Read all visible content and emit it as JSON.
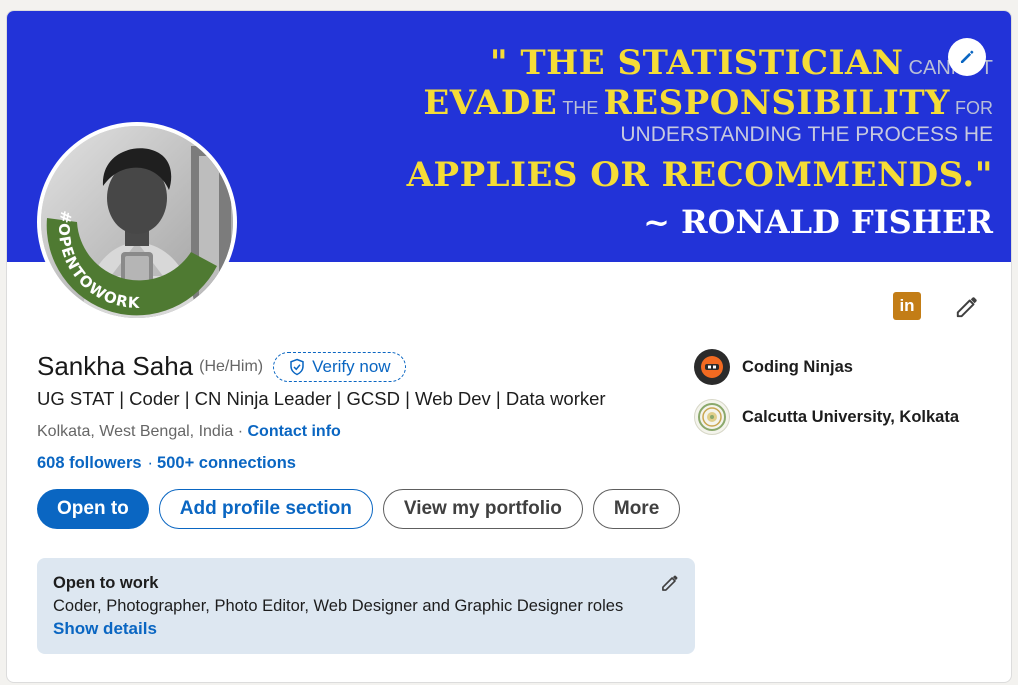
{
  "banner": {
    "quote_line1_open": "\" THE  STATISTICIAN",
    "quote_line1_small": "CANNOT",
    "quote_line2_a": "EVADE",
    "quote_line2_b": "THE",
    "quote_line2_c": "RESPONSIBILITY",
    "quote_line2_d": "FOR",
    "quote_line3": "UNDERSTANDING THE PROCESS HE",
    "quote_line4": "APPLIES OR RECOMMENDS.\"",
    "quote_author": "~ RONALD FISHER",
    "bg_color": "#2233d8"
  },
  "avatar": {
    "badge_text": "#OPENTOWORK",
    "ring_color": "#4f7a32"
  },
  "profile": {
    "name": "Sankha Saha",
    "pronouns": "(He/Him)",
    "verify_label": "Verify now",
    "headline": "UG STAT | Coder | CN Ninja Leader | GCSD | Web Dev | Data worker",
    "location": "Kolkata, West Bengal, India",
    "location_separator": " · ",
    "contact_info": "Contact info",
    "followers": "608 followers",
    "network_separator": "·",
    "connections": "500+ connections"
  },
  "actions": {
    "open_to": "Open to",
    "add_section": "Add profile section",
    "portfolio": "View my portfolio",
    "more": "More"
  },
  "open_to_work": {
    "title": "Open to work",
    "roles": "Coder, Photographer, Photo Editor, Web Designer and Graphic Designer roles",
    "show_details": "Show details"
  },
  "organizations": [
    {
      "name": "Coding Ninjas",
      "icon": "coding-ninjas-logo"
    },
    {
      "name": "Calcutta University, Kolkata",
      "icon": "calcutta-university-logo"
    }
  ],
  "icons": {
    "linkedin_badge": "in",
    "accent": "#0a66c2"
  }
}
